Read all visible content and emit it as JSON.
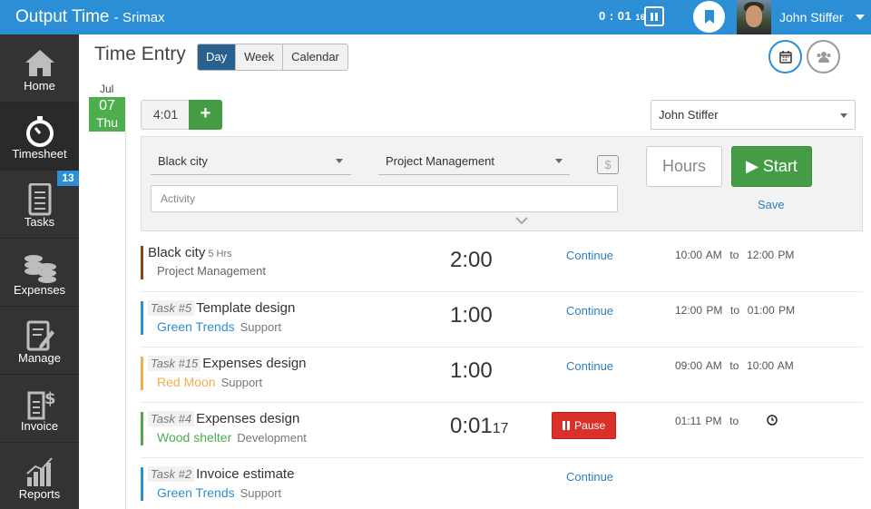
{
  "app": {
    "title": "Output Time",
    "subtitle": "- Srimax",
    "timer_main": "0 : 01",
    "timer_sec": "16",
    "user": "John Stiffer"
  },
  "colors": {
    "accent": "#2c8fd6",
    "sidebar": "#333333",
    "success": "#449d44",
    "danger": "#d9302a"
  },
  "sidebar": {
    "items": [
      {
        "label": "Home",
        "icon": "home-icon"
      },
      {
        "label": "Timesheet",
        "icon": "stopwatch-icon"
      },
      {
        "label": "Tasks",
        "icon": "clipboard-icon",
        "badge": "13"
      },
      {
        "label": "Expenses",
        "icon": "coins-icon"
      },
      {
        "label": "Manage",
        "icon": "edit-document-icon"
      },
      {
        "label": "Invoice",
        "icon": "invoice-dollar-icon"
      },
      {
        "label": "Reports",
        "icon": "bar-chart-icon"
      }
    ]
  },
  "header": {
    "title": "Time Entry",
    "views": [
      "Day",
      "Week",
      "Calendar"
    ],
    "active_view": "Day"
  },
  "date": {
    "month": "Jul",
    "day": "07",
    "weekday": "Thu"
  },
  "quick_time": "4:01",
  "user_select": "John Stiffer",
  "entry": {
    "client": "Black city",
    "task": "Project Management",
    "billable_symbol": "$",
    "activity_placeholder": "Activity",
    "hours_placeholder": "Hours",
    "start_label": "Start",
    "save_label": "Save"
  },
  "entries": [
    {
      "task_no": "",
      "title": "Black city",
      "hrs": "5 Hrs",
      "project": "",
      "category": "",
      "subline": "Project Management",
      "duration": "2:00",
      "duration_sec": "",
      "action": "Continue",
      "start": "10:00 AM",
      "to": "to",
      "end": "12:00 PM",
      "color": "#8b4513"
    },
    {
      "task_no": "Task #5",
      "title": "Template design",
      "hrs": "",
      "project": "Green Trends",
      "category": "Support",
      "subline": "",
      "duration": "1:00",
      "duration_sec": "",
      "action": "Continue",
      "start": "12:00 PM",
      "to": "to",
      "end": "01:00 PM",
      "color": "#2c8fd6"
    },
    {
      "task_no": "Task #15",
      "title": "Expenses design",
      "hrs": "",
      "project": "Red Moon",
      "category": "Support",
      "subline": "",
      "duration": "1:00",
      "duration_sec": "",
      "action": "Continue",
      "start": "09:00 AM",
      "to": "to",
      "end": "10:00 AM",
      "color": "#f0ad4e"
    },
    {
      "task_no": "Task #4",
      "title": "Expenses design",
      "hrs": "",
      "project": "Wood shelter",
      "category": "Development",
      "subline": "",
      "duration": "0:01",
      "duration_sec": "17",
      "action": "Pause",
      "start": "01:11 PM",
      "to": "to",
      "end": "",
      "color": "#4cae4c"
    },
    {
      "task_no": "Task #2",
      "title": "Invoice estimate",
      "hrs": "",
      "project": "Green Trends",
      "category": "Support",
      "subline": "",
      "duration": "",
      "duration_sec": "",
      "action": "Continue",
      "start": "",
      "to": "",
      "end": "",
      "color": "#2c8fd6"
    }
  ]
}
